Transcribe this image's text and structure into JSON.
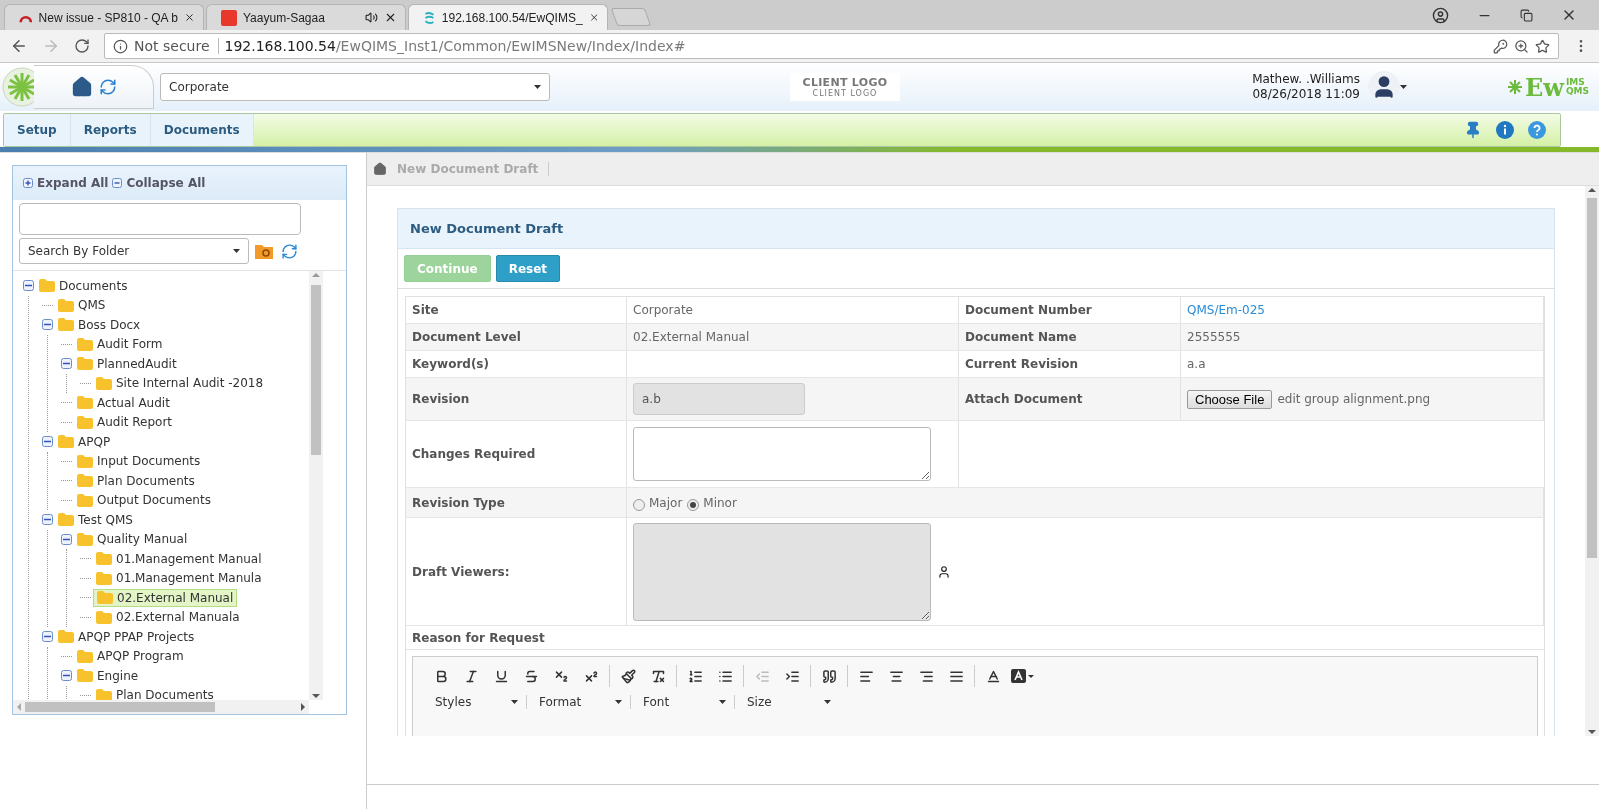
{
  "browser": {
    "tabs": [
      {
        "title": "New issue - SP810 - QA b",
        "selected": false,
        "audio": false
      },
      {
        "title": "Yaayum-Sagaa",
        "selected": false,
        "audio": true
      },
      {
        "title": "192.168.100.54/EwQIMS_",
        "selected": true,
        "audio": false
      }
    ],
    "address": {
      "security": "Not secure",
      "host": "192.168.100.54",
      "path": "/EwQIMS_Inst1/Common/EwIMSNew/Index/Index#"
    }
  },
  "header": {
    "site": "Corporate",
    "client_logo": {
      "title": "CLIENT LOGO",
      "subtitle": "CLIENT LOGO"
    },
    "user": {
      "name": "Mathew. .Williams",
      "datetime": "08/26/2018 11:09"
    },
    "brand": {
      "main": "Ew",
      "top": "IMS",
      "bottom": "QMS"
    }
  },
  "menu": [
    "Setup",
    "Reports",
    "Documents"
  ],
  "sidebar": {
    "expand_all": "Expand All",
    "collapse_all": "Collapse All",
    "search_by": "Search By Folder",
    "tree": [
      {
        "label": "Documents",
        "selected": false,
        "expanded": true,
        "children": [
          {
            "label": "QMS",
            "selected": false
          },
          {
            "label": "Boss Docx",
            "selected": false,
            "expanded": true,
            "children": [
              {
                "label": "Audit Form",
                "selected": false
              },
              {
                "label": "PlannedAudit",
                "selected": false,
                "expanded": true,
                "children": [
                  {
                    "label": "Site Internal Audit -2018",
                    "selected": false
                  }
                ]
              },
              {
                "label": "Actual Audit",
                "selected": false
              },
              {
                "label": "Audit Report",
                "selected": false
              }
            ]
          },
          {
            "label": "APQP",
            "selected": false,
            "expanded": true,
            "children": [
              {
                "label": "Input Documents",
                "selected": false
              },
              {
                "label": "Plan Documents",
                "selected": false
              },
              {
                "label": "Output Documents",
                "selected": false
              }
            ]
          },
          {
            "label": "Test QMS",
            "selected": false,
            "expanded": true,
            "children": [
              {
                "label": "Quality Manual",
                "selected": false,
                "expanded": true,
                "children": [
                  {
                    "label": "01.Management Manual",
                    "selected": false
                  },
                  {
                    "label": "01.Management Manula",
                    "selected": false
                  },
                  {
                    "label": "02.External Manual",
                    "selected": true
                  },
                  {
                    "label": "02.External Manuala",
                    "selected": false
                  }
                ]
              }
            ]
          },
          {
            "label": "APQP PPAP Projects",
            "selected": false,
            "expanded": true,
            "children": [
              {
                "label": "APQP Program",
                "selected": false
              },
              {
                "label": "Engine",
                "selected": false,
                "expanded": true,
                "children": [
                  {
                    "label": "Plan Documents",
                    "selected": false
                  }
                ]
              }
            ]
          }
        ]
      }
    ]
  },
  "breadcrumb": [
    "New Document Draft"
  ],
  "form": {
    "title": "New Document Draft",
    "buttons": [
      {
        "label": "Continue",
        "kind": "success",
        "disabled": true
      },
      {
        "label": "Reset",
        "kind": "info",
        "disabled": false
      }
    ],
    "rows": [
      {
        "label": "Site",
        "value": {
          "kind": "text",
          "text": "Corporate"
        },
        "right": {
          "label": "Document Number",
          "value": {
            "kind": "link",
            "text": "QMS/Em-025"
          }
        }
      },
      {
        "label": "Document Level",
        "value": {
          "kind": "text",
          "text": "02.External Manual"
        },
        "right": {
          "label": "Document Name",
          "value": {
            "kind": "text",
            "text": "2555555"
          }
        }
      },
      {
        "label": "Keyword(s)",
        "right": {
          "label": "Current Revision",
          "value": {
            "kind": "text",
            "text": "a.a"
          }
        }
      },
      {
        "label": "Revision",
        "value": {
          "kind": "input",
          "text": "a.b",
          "disabled": true
        },
        "right": {
          "label": "Attach Document",
          "value": {
            "kind": "file",
            "button": "Choose File",
            "file_name": "edit group alignment.png"
          }
        }
      },
      {
        "label": "Changes Required",
        "value": {
          "kind": "textarea",
          "disabled": false,
          "picker": false
        }
      },
      {
        "label": "Revision Type",
        "value": {
          "kind": "radio",
          "options": [
            {
              "label": "Major",
              "selected": false
            },
            {
              "label": "Minor",
              "selected": true
            }
          ]
        }
      },
      {
        "label": "Draft Viewers:",
        "value": {
          "kind": "textarea",
          "disabled": true,
          "picker": true
        }
      }
    ],
    "reason": {
      "label": "Reason for Request",
      "toolbar": [
        [
          {
            "kind": "bold",
            "disabled": false
          },
          {
            "kind": "italic",
            "disabled": false
          },
          {
            "kind": "underline",
            "disabled": false
          },
          {
            "kind": "strike",
            "disabled": false
          },
          {
            "kind": "subscript",
            "disabled": false
          },
          {
            "kind": "superscript",
            "disabled": false
          }
        ],
        [
          {
            "kind": "paint",
            "disabled": false
          },
          {
            "kind": "clear",
            "disabled": false
          }
        ],
        [
          {
            "kind": "ordered",
            "disabled": false
          },
          {
            "kind": "bullets",
            "disabled": false
          }
        ],
        [
          {
            "kind": "outdent",
            "disabled": true
          },
          {
            "kind": "indent",
            "disabled": false
          }
        ],
        [
          {
            "kind": "quote",
            "disabled": false
          }
        ],
        [
          {
            "kind": "left",
            "disabled": false
          },
          {
            "kind": "center",
            "disabled": false
          },
          {
            "kind": "right",
            "disabled": false
          },
          {
            "kind": "justify",
            "disabled": false
          }
        ],
        [
          {
            "kind": "text_color",
            "disabled": false
          },
          {
            "kind": "bg_color",
            "disabled": false
          }
        ]
      ],
      "dropdowns": [
        "Styles",
        "Format",
        "Font",
        "Size"
      ]
    }
  }
}
